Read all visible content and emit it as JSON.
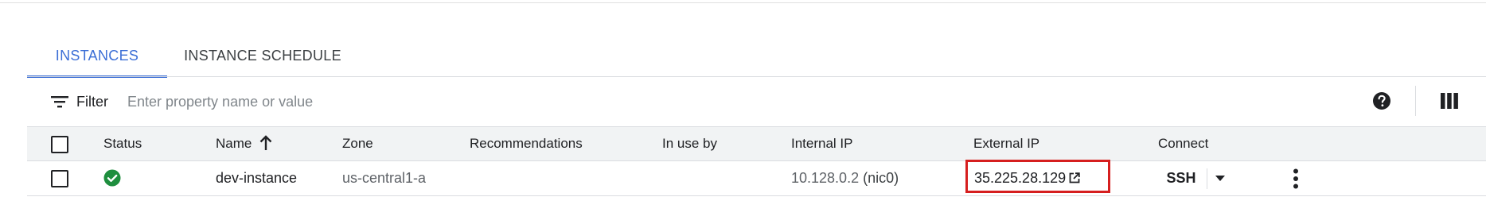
{
  "tabs": [
    {
      "label": "INSTANCES",
      "active": true
    },
    {
      "label": "INSTANCE SCHEDULE",
      "active": false
    }
  ],
  "filter": {
    "label": "Filter",
    "placeholder": "Enter property name or value",
    "icon": "filter-icon"
  },
  "toolbar": {
    "help_icon": "help-icon",
    "columns_icon": "column-display-icon"
  },
  "table": {
    "headers": {
      "status": "Status",
      "name": "Name",
      "zone": "Zone",
      "recommendations": "Recommendations",
      "in_use_by": "In use by",
      "internal_ip": "Internal IP",
      "external_ip": "External IP",
      "connect": "Connect"
    },
    "sort": {
      "column": "name",
      "direction": "ascending"
    },
    "rows": [
      {
        "status": "running",
        "name": "dev-instance",
        "zone": "us-central1-a",
        "recommendations": "",
        "in_use_by": "",
        "internal_ip": "10.128.0.2",
        "internal_nic": "(nic0)",
        "external_ip": "35.225.28.129",
        "connect_label": "SSH"
      }
    ]
  },
  "colors": {
    "accent": "#3c6fd6",
    "status_ok": "#1e8e3e",
    "highlight_box": "#d61f1f"
  }
}
